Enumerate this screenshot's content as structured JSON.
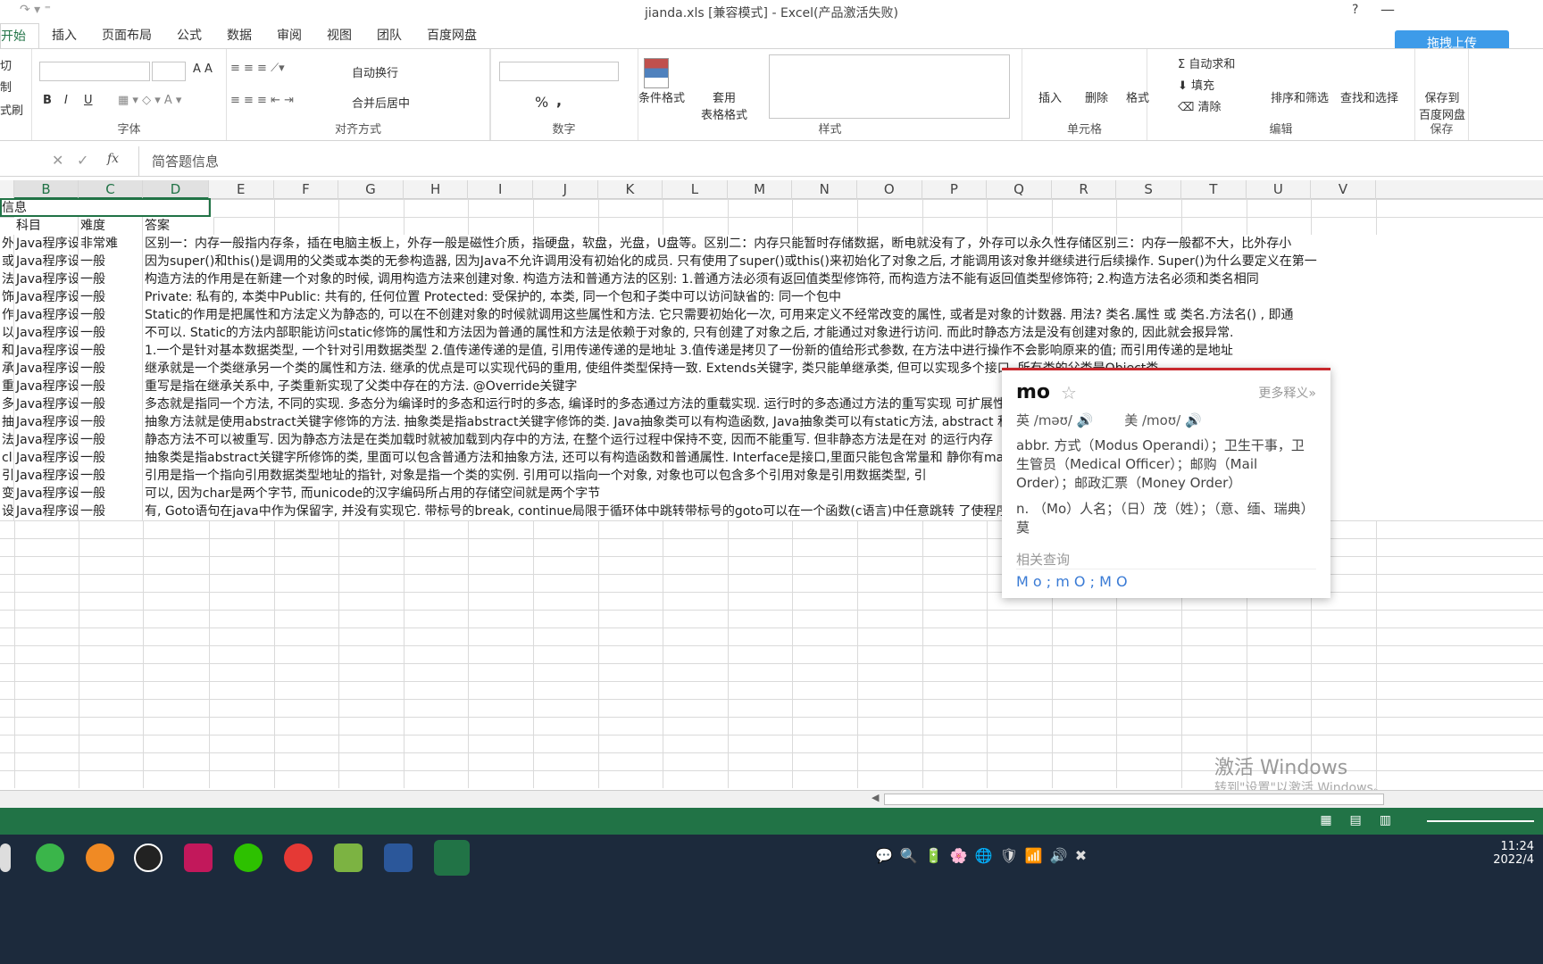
{
  "window": {
    "title": "jianda.xls  [兼容模式] - Excel(产品激活失败)",
    "help": "?"
  },
  "tabs": [
    "开始",
    "插入",
    "页面布局",
    "公式",
    "数据",
    "审阅",
    "视图",
    "团队",
    "百度网盘"
  ],
  "baidu_upload": "拖拽上传",
  "ribbon": {
    "clipboard": [
      "切",
      "制",
      "式刷"
    ],
    "font_group": "字体",
    "align_group": "对齐方式",
    "number_group": "数字",
    "styles_group": "样式",
    "cells_group": "单元格",
    "edit_group": "编辑",
    "save_group": "保存",
    "wrap_text": "自动换行",
    "merge_center": "合并后居中",
    "cond_format": "条件格式",
    "table_format": "套用\n表格格式",
    "insert": "插入",
    "delete": "删除",
    "format": "格式",
    "autosum": "自动求和",
    "fill": "填充",
    "clear": "清除",
    "sort_filter": "排序和筛选",
    "find_select": "查找和选择",
    "save_baidu": "保存到\n百度网盘",
    "bold": "B",
    "italic": "I",
    "underline": "U",
    "percent": "%",
    "comma": ","
  },
  "formula_bar": {
    "value": "简答题信息",
    "fx": "fx"
  },
  "columns": [
    "B",
    "C",
    "D",
    "E",
    "F",
    "G",
    "H",
    "I",
    "J",
    "K",
    "L",
    "M",
    "N",
    "O",
    "P",
    "Q",
    "R",
    "S",
    "T",
    "U",
    "V"
  ],
  "row1": "信息",
  "headers": {
    "b": "科目",
    "c": "难度",
    "d": "答案"
  },
  "rows": [
    {
      "a": "外存",
      "b": "Java程序设",
      "c": "非常难",
      "d": "区别一：内存一般指内存条，插在电脑主板上，外存一般是磁性介质，指硬盘，软盘，光盘，U盘等。区别二：内存只能暂时存储数据，断电就没有了，外存可以永久性存储区别三：内存一般都不大，比外存小"
    },
    {
      "a": "或者",
      "b": "Java程序设",
      "c": "一般",
      "d": "因为super()和this()是调用的父类或本类的无参构造器, 因为Java不允许调用没有初始化的成员. 只有使用了super()或this()来初始化了对象之后, 才能调用该对象并继续进行后续操作. Super()为什么要定义在第一"
    },
    {
      "a": "法的",
      "b": "Java程序设",
      "c": "一般",
      "d": "构造方法的作用是在新建一个对象的时候, 调用构造方法来创建对象. 构造方法和普通方法的区别:        1.普通方法必须有返回值类型修饰符, 而构造方法不能有返回值类型修饰符;        2.构造方法名必须和类名相同"
    },
    {
      "a": "饰符",
      "b": "Java程序设",
      "c": "一般",
      "d": "Private: 私有的, 本类中Public: 共有的, 任何位置 Protected: 受保护的, 本类, 同一个包和子类中可以访问缺省的: 同一个包中"
    },
    {
      "a": "作用",
      "b": "Java程序设",
      "c": "一般",
      "d": "Static的作用是把属性和方法定义为静态的, 可以在不创建对象的时候就调用这些属性和方法. 它只需要初始化一次, 可用来定义不经常改变的属性, 或者是对象的计数器. 用法? 类名.属性 或 类名.方法名() , 即通"
    },
    {
      "a": "以从",
      "b": "Java程序设",
      "c": "一般",
      "d": "不可以. Static的方法内部职能访问static修饰的属性和方法因为普通的属性和方法是依赖于对象的, 只有创建了对象之后, 才能通过对象进行访问. 而此时静态方法是没有创建对象的, 因此就会报异常."
    },
    {
      "a": "和引",
      "b": "Java程序设",
      "c": "一般",
      "d": "        1.一个是针对基本数据类型, 一个针对引用数据类型        2.值传递传递的是值, 引用传递传递的是地址        3.值传递是拷贝了一份新的值给形式参数, 在方法中进行操作不会影响原来的值; 而引用传递的是地址"
    },
    {
      "a": "承?",
      "b": "Java程序设",
      "c": "一般",
      "d": "继承就是一个类继承另一个类的属性和方法. 继承的优点是可以实现代码的重用, 使组件类型保持一致. Extends关键字, 类只能单继承类, 但可以实现多个接口. 所有类的父类是Object类"
    },
    {
      "a": "重写",
      "b": "Java程序设",
      "c": "一般",
      "d": "重写是指在继承关系中, 子类重新实现了父类中存在的方法. @Override关键字"
    },
    {
      "a": "多态",
      "b": "Java程序设",
      "c": "一般",
      "d": "多态就是指同一个方法, 不同的实现. 多态分为编译时的多态和运行时的多态, 编译时的多态通过方法的重载实现. 运行时的多态通过方法的重写实现                                             可扩展性"
    },
    {
      "a": "抽象",
      "b": "Java程序设",
      "c": "一般",
      "d": "抽象方法就是使用abstract关键字修饰的方法. 抽象类是指abstract关键字修饰的类. Java抽象类可以有构造函数, Java抽象类可以有static方法, abstract                                        和实现, 而static"
    },
    {
      "a": "法可",
      "b": "Java程序设",
      "c": "一般",
      "d": "静态方法不可以被重写. 因为静态方法是在类加载时就被加载到内存中的方法, 在整个运行过程中保持不变, 因而不能重写. 但非静态方法是在对                                        的运行内存"
    },
    {
      "a": "cl",
      "b": "Java程序设",
      "c": "一般",
      "d": "抽象类是指abstract关键字所修饰的类, 里面可以包含普通方法和抽象方法, 还可以有构造函数和普通属性. Interface是接口,里面只能包含常量和                                        静你有main方"
    },
    {
      "a": "引用",
      "b": "Java程序设",
      "c": "一般",
      "d": "引用是指一个指向引用数据类型地址的指针, 对象是指一个类的实例. 引用可以指向一个对象, 对象也可以包含多个引用对象是引用数据类型, 引"
    },
    {
      "a": "变量",
      "b": "Java程序设",
      "c": "一般",
      "d": "可以, 因为char是两个字节, 而unicode的汉字编码所占用的存储空间就是两个字节"
    },
    {
      "a": "设有",
      "b": "Java程序设",
      "c": "一般",
      "d": "有, Goto语句在java中作为保留字, 并没有实现它. 带标号的break, continue局限于循环体中跳转带标号的goto可以在一个函数(c语言)中任意跳转                                        了使程序的"
    }
  ],
  "dictionary_popup": {
    "word": "mo",
    "more": "更多释义»",
    "uk": "英 /məʊ/",
    "us": "美 /moʊ/",
    "abbr": "abbr. 方式（Modus Operandi）；卫生干事，卫生管员（Medical Officer）；邮购（Mail Order）；邮政汇票（Money Order）",
    "noun": "n. （Mo）人名；（日）茂（姓）；（意、缅、瑞典）莫",
    "related_label": "相关查询",
    "related": [
      "M o",
      "m O",
      "M O"
    ]
  },
  "watermark": {
    "line1": "激活 Windows",
    "line2": "转到\"设置\"以激活 Windows。"
  },
  "clock": {
    "time": "11:24",
    "date": "2022/4"
  },
  "colors": {
    "excel_green": "#217346",
    "popup_red": "#c8282d",
    "link_blue": "#3a7bd5"
  }
}
